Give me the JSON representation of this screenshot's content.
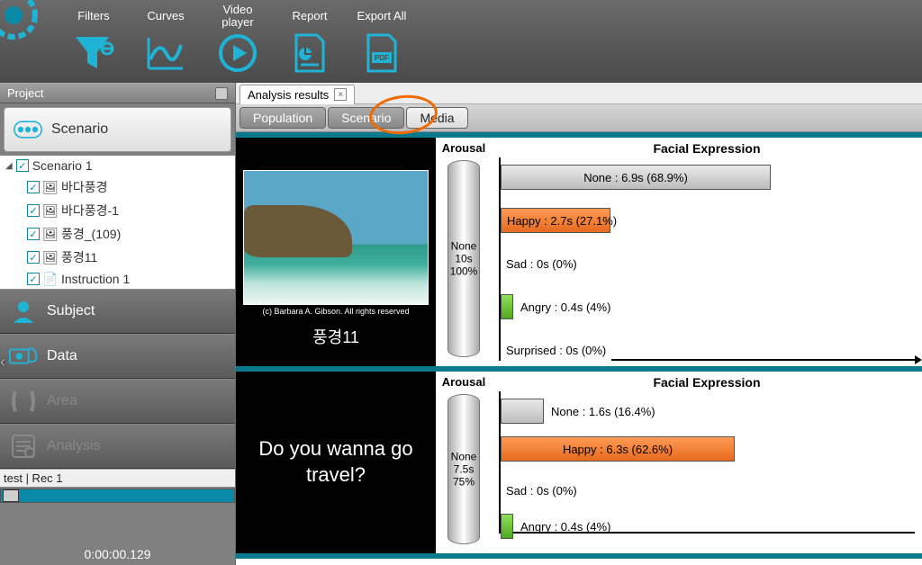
{
  "toolbar": {
    "filters": "Filters",
    "curves": "Curves",
    "video_player": "Video player",
    "report": "Report",
    "export_all": "Export All"
  },
  "project": {
    "title": "Project",
    "sections": {
      "scenario": "Scenario",
      "subject": "Subject",
      "data": "Data",
      "area": "Area",
      "analysis": "Analysis"
    },
    "tree": {
      "root": "Scenario 1",
      "items": [
        "바다풍경",
        "바다풍경-1",
        "풍경_(109)",
        "풍경11",
        "Instruction 1"
      ]
    },
    "footer_label": "test | Rec 1",
    "timecode": "0:00:00.129"
  },
  "tabs": {
    "doc": "Analysis results",
    "sub": {
      "population": "Population",
      "scenario": "Scenario",
      "media": "Media"
    }
  },
  "rows": [
    {
      "thumb_label": "풍경11",
      "thumb_credit": "(c) Barbara A. Gibson. All rights reserved",
      "arousal_title": "Arousal",
      "arousal_value": "None\n10s\n100%",
      "chart_title": "Facial Expression",
      "bars": {
        "none": "None : 6.9s (68.9%)",
        "happy": "Happy : 2.7s (27.1%)",
        "sad": "Sad : 0s (0%)",
        "angry": "Angry : 0.4s (4%)",
        "surprised": "Surprised : 0s (0%)"
      }
    },
    {
      "thumb_text": "Do you wanna go travel?",
      "arousal_title": "Arousal",
      "arousal_value": "None\n7.5s\n75%",
      "chart_title": "Facial Expression",
      "bars": {
        "none": "None : 1.6s (16.4%)",
        "happy": "Happy : 6.3s (62.6%)",
        "sad": "Sad : 0s (0%)",
        "angry": "Angry : 0.4s (4%)"
      }
    }
  ],
  "chart_data": [
    {
      "type": "bar",
      "title": "Facial Expression",
      "categories": [
        "None",
        "Happy",
        "Sad",
        "Angry",
        "Surprised"
      ],
      "series": [
        {
          "name": "seconds",
          "values": [
            6.9,
            2.7,
            0,
            0.4,
            0
          ]
        },
        {
          "name": "percent",
          "values": [
            68.9,
            27.1,
            0,
            4,
            0
          ]
        }
      ],
      "xlabel": "",
      "ylabel": "",
      "layout": "horizontal",
      "arousal": {
        "label": "None",
        "seconds": 10,
        "percent": 100
      }
    },
    {
      "type": "bar",
      "title": "Facial Expression",
      "categories": [
        "None",
        "Happy",
        "Sad",
        "Angry"
      ],
      "series": [
        {
          "name": "seconds",
          "values": [
            1.6,
            6.3,
            0,
            0.4
          ]
        },
        {
          "name": "percent",
          "values": [
            16.4,
            62.6,
            0,
            4
          ]
        }
      ],
      "xlabel": "",
      "ylabel": "",
      "layout": "horizontal",
      "arousal": {
        "label": "None",
        "seconds": 7.5,
        "percent": 75
      }
    }
  ]
}
